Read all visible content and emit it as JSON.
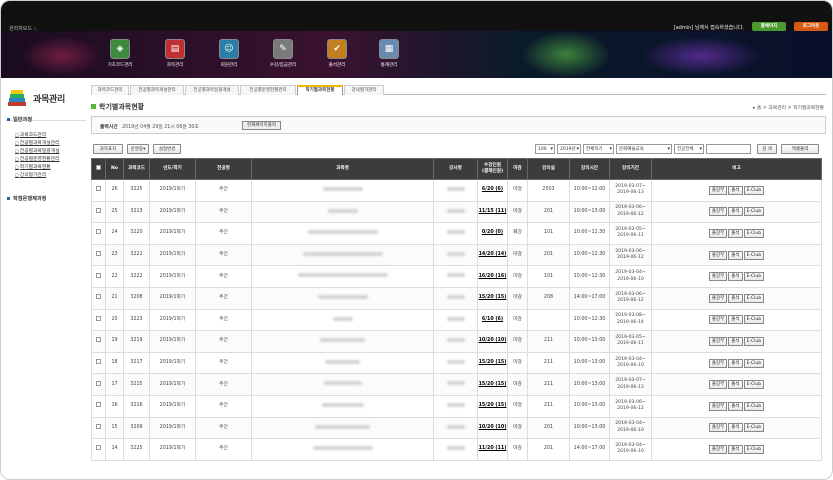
{
  "app": {
    "title": "관리자모드 ::",
    "welcome": "[admin] 님께서 접속하셨습니다.",
    "home_label": "홈페이지",
    "logout_label": "로그아웃"
  },
  "nav": [
    {
      "label": "기초코드관리",
      "icon": "code-icon",
      "color": "#3d8a3d"
    },
    {
      "label": "과목관리",
      "icon": "book-icon",
      "color": "#c03030"
    },
    {
      "label": "회원관리",
      "icon": "members-icon",
      "color": "#2a7fa8"
    },
    {
      "label": "수강/입금관리",
      "icon": "payment-icon",
      "color": "#7a7a7a"
    },
    {
      "label": "출석관리",
      "icon": "attendance-icon",
      "color": "#c08020"
    },
    {
      "label": "통계관리",
      "icon": "stats-icon",
      "color": "#6a8ab0"
    }
  ],
  "sidebar": {
    "logo_text": "과목관리",
    "sections": [
      {
        "label": "일반과정",
        "items": [
          "과목코드관리",
          "전공별과목개설관리",
          "전공별과목일괄개설",
          "전공별운영현황관리",
          "학기별과목현황",
          "강의평가관리"
        ]
      },
      {
        "label": "학점은행제과정",
        "items": []
      }
    ]
  },
  "tabs": [
    "과목코드관리",
    "전공별과목개설관리",
    "전공별과목일괄개설",
    "전공별운영현황관리",
    "학기별과목현황",
    "강의평가관리"
  ],
  "page": {
    "title": "학기별과목현황",
    "breadcrumb": "▸ 홈 > 과목관리 > 학기별과목현황"
  },
  "info": {
    "label": "출력시간",
    "text": "2019년 04월 29일 21시 06분 30초",
    "button": "현재페이지출력"
  },
  "toolbar": {
    "btn_subject": "과목표지",
    "btn_sort": "운영중▾",
    "btn_setting": "설정변경",
    "sel_count": "100",
    "sel_year": "2019년",
    "sel_term": "전체학기",
    "sel_dept": "문화예술교육",
    "sel_major": "전공전체",
    "btn_search": "검 색",
    "btn_excel": "엑셀출력"
  },
  "table": {
    "headers": [
      "No",
      "과목코드",
      "년도/학기",
      "전공명",
      "과목명",
      "강사명",
      "수강인원\n(결제인원)",
      "마감",
      "강의실",
      "강의시간",
      "강의기간",
      "비고"
    ],
    "row_buttons": [
      "출강부",
      "출석",
      "E-Club"
    ],
    "rows": [
      {
        "no": "26",
        "code": "3225",
        "term": "2019/1학기",
        "major": "주간",
        "enroll": "6/20 (6)",
        "status": "마감",
        "room": "2503",
        "time": "10:00~12:00",
        "period": [
          "2019-03-07~",
          "2019-06-13"
        ]
      },
      {
        "no": "25",
        "code": "3213",
        "term": "2019/1학기",
        "major": "주간",
        "enroll": "11/15 (11)",
        "status": "마감",
        "room": "201",
        "time": "10:00~13:00",
        "period": [
          "2019-03-06~",
          "2019-06-12"
        ]
      },
      {
        "no": "24",
        "code": "3220",
        "term": "2019/1학기",
        "major": "주간",
        "enroll": "0/20 (0)",
        "status": "폐강",
        "room": "101",
        "time": "10:00~12:30",
        "period": [
          "2019-03-05~",
          "2019-06-11"
        ]
      },
      {
        "no": "23",
        "code": "3221",
        "term": "2019/1학기",
        "major": "주간",
        "enroll": "14/20 (14)",
        "status": "마감",
        "room": "201",
        "time": "10:00~12:30",
        "period": [
          "2019-03-06~",
          "2019-06-12"
        ]
      },
      {
        "no": "22",
        "code": "3222",
        "term": "2019/1학기",
        "major": "주간",
        "enroll": "16/20 (16)",
        "status": "마감",
        "room": "101",
        "time": "10:00~12:30",
        "period": [
          "2019-03-04~",
          "2019-06-10"
        ]
      },
      {
        "no": "21",
        "code": "3208",
        "term": "2019/1학기",
        "major": "주간",
        "enroll": "15/20 (15)",
        "status": "마감",
        "room": "208",
        "time": "14:00~17:00",
        "period": [
          "2019-03-06~",
          "2019-06-12"
        ]
      },
      {
        "no": "20",
        "code": "3223",
        "term": "2019/1학기",
        "major": "주간",
        "enroll": "6/10 (6)",
        "status": "마감",
        "room": "",
        "time": "10:00~12:30",
        "period": [
          "2019-03-08~",
          "2019-06-14"
        ]
      },
      {
        "no": "19",
        "code": "3219",
        "term": "2019/1학기",
        "major": "주간",
        "enroll": "10/20 (10)",
        "status": "마감",
        "room": "211",
        "time": "10:00~13:00",
        "period": [
          "2019-03-05~",
          "2019-06-11"
        ]
      },
      {
        "no": "18",
        "code": "3217",
        "term": "2019/1학기",
        "major": "주간",
        "enroll": "15/20 (15)",
        "status": "마감",
        "room": "211",
        "time": "10:00~13:00",
        "period": [
          "2019-03-04~",
          "2019-06-10"
        ]
      },
      {
        "no": "17",
        "code": "3215",
        "term": "2019/1학기",
        "major": "주간",
        "enroll": "15/20 (15)",
        "status": "마감",
        "room": "211",
        "time": "10:00~13:00",
        "period": [
          "2019-03-07~",
          "2019-06-13"
        ]
      },
      {
        "no": "16",
        "code": "3216",
        "term": "2019/1학기",
        "major": "주간",
        "enroll": "15/20 (15)",
        "status": "마감",
        "room": "211",
        "time": "10:00~13:00",
        "period": [
          "2019-03-06~",
          "2019-06-12"
        ]
      },
      {
        "no": "15",
        "code": "3209",
        "term": "2019/1학기",
        "major": "주간",
        "enroll": "10/20 (10)",
        "status": "마감",
        "room": "201",
        "time": "10:00~13:00",
        "period": [
          "2019-03-04~",
          "2019-06-10"
        ]
      },
      {
        "no": "14",
        "code": "3225",
        "term": "2019/1학기",
        "major": "주간",
        "enroll": "11/20 (11)",
        "status": "마감",
        "room": "201",
        "time": "14:00~17:00",
        "period": [
          "2019-03-04~",
          "2019-06-10"
        ]
      }
    ]
  }
}
